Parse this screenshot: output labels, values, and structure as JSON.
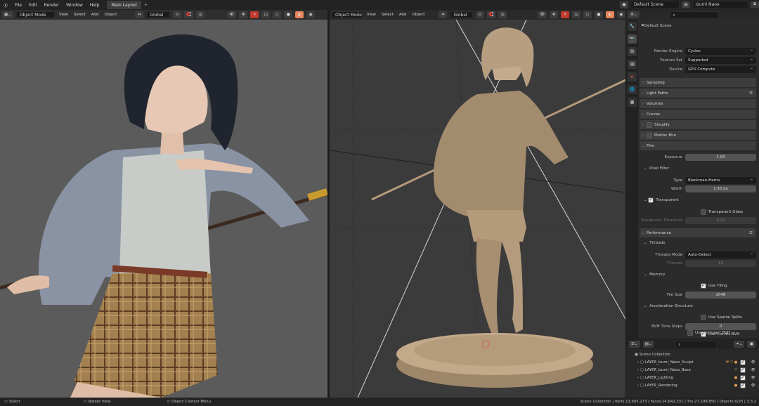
{
  "menu": [
    "File",
    "Edit",
    "Render",
    "Window",
    "Help"
  ],
  "workspace_tab": "Main Layout",
  "workspace_add": "+",
  "scene": "Default Scene",
  "view_layer": "Izumi Naoe",
  "viewport": {
    "mode": "Object Mode",
    "menus": [
      "View",
      "Select",
      "Add",
      "Object"
    ],
    "transform": "Global"
  },
  "properties": {
    "breadcrumb": "Default Scene",
    "render_engine_label": "Render Engine",
    "render_engine": "Cycles",
    "feature_set_label": "Feature Set",
    "feature_set": "Supported",
    "device_label": "Device",
    "device": "GPU Compute",
    "panels": {
      "sampling": "Sampling",
      "light_paths": "Light Paths",
      "volumes": "Volumes",
      "curves": "Curves",
      "simplify": "Simplify",
      "motion_blur": "Motion Blur",
      "film": "Film",
      "performance": "Performance"
    },
    "exposure_label": "Exposure",
    "exposure": "1.00",
    "pixel_filter": "Pixel Filter",
    "type_label": "Type",
    "type": "Blackman-Harris",
    "width_label": "Width",
    "width": "1.50 px",
    "transparent": "Transparent",
    "transparent_glass": "Transparent Glass",
    "roughness_label": "Roughness Threshold",
    "roughness": "0.10",
    "threads": "Threads",
    "threads_mode_label": "Threads Mode",
    "threads_mode": "Auto-Detect",
    "threads_label": "Threads",
    "threads_value": "12",
    "memory": "Memory",
    "use_tiling": "Use Tiling",
    "tile_size_label": "Tile Size",
    "tile_size": "2048",
    "accel": "Acceleration Structure",
    "use_spatial_splits": "Use Spatial Splits",
    "bvh_label": "BVH Time Steps",
    "bvh": "0",
    "use_curves_bvh": "Use Curves BVH",
    "use_compact_bvh": "Use Compact BVH"
  },
  "outliner": {
    "root": "Scene Collection",
    "items": [
      "LAYER_Izumi_Naoe_Sculpt",
      "LAYER_Izumi_Naoe_Base",
      "LAYER_Lighting",
      "LAYER_Rendering"
    ]
  },
  "status": {
    "select": "Select",
    "rotate": "Rotate View",
    "context": "Object Context Menu",
    "stats": "Scene Collection | Verts:13,605,273 | Faces:14,642,331 | Tris:27,199,850 | Objects:0/25 | 3.3.2"
  }
}
